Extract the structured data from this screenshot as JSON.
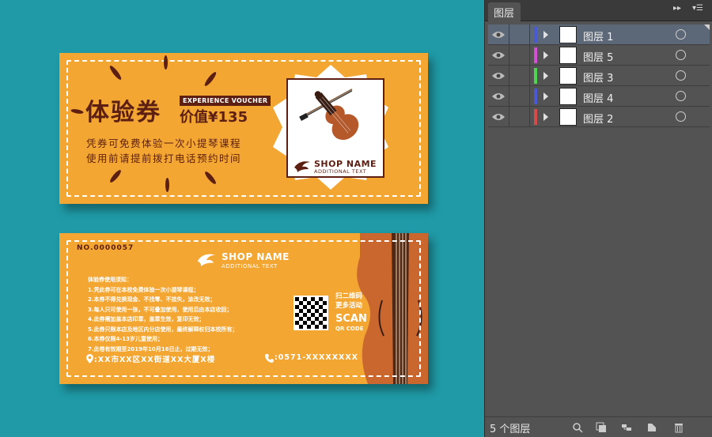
{
  "front": {
    "title": "体验券",
    "tag": "EXPERIENCE VOUCHER",
    "price": "价值¥135",
    "line1": "凭券可免费体验一次小提琴课程",
    "line2": "使用前请提前拨打电话预约时间",
    "shop_name": "SHOP NAME",
    "shop_sub": "ADDITIONAL TEXT"
  },
  "back": {
    "number": "NO.0000057",
    "shop_name": "SHOP NAME",
    "shop_sub": "ADDITIONAL TEXT",
    "rules": [
      "体验券使用须知：",
      "1.凭此券可在本校免费体验一次小提琴课程；",
      "2.本券不得兑换现金、不找零、不挂失，涂改无效；",
      "3.每人只可使用一张，不可叠加使用，使用后由本店收回；",
      "4.此券需加盖本店印章，盖章生效，复印无效；",
      "5.此券只限本店及地区内分店使用，最终解释权归本校所有；",
      "6.本券仅限4-13岁儿童使用；",
      "7.此卷有效期至2019年10月16日止，过期无效；"
    ],
    "address": ":XX市XX区XX街道XX大厦X楼",
    "phone": ":0571-XXXXXXXX",
    "scan_cn_1": "扫二维码",
    "scan_cn_2": "更多活动",
    "scan_en": "SCAN",
    "scan_en_2": "QR CODE"
  },
  "panel": {
    "tab": "图层",
    "layers": [
      {
        "name": "图层 1",
        "color": "#4a5ad6",
        "selected": true
      },
      {
        "name": "图层 5",
        "color": "#d54fd6",
        "selected": false
      },
      {
        "name": "图层 3",
        "color": "#4fd64f",
        "selected": false
      },
      {
        "name": "图层 4",
        "color": "#4a5ad6",
        "selected": false
      },
      {
        "name": "图层 2",
        "color": "#d64a4a",
        "selected": false
      }
    ],
    "count": "5 个图层"
  }
}
